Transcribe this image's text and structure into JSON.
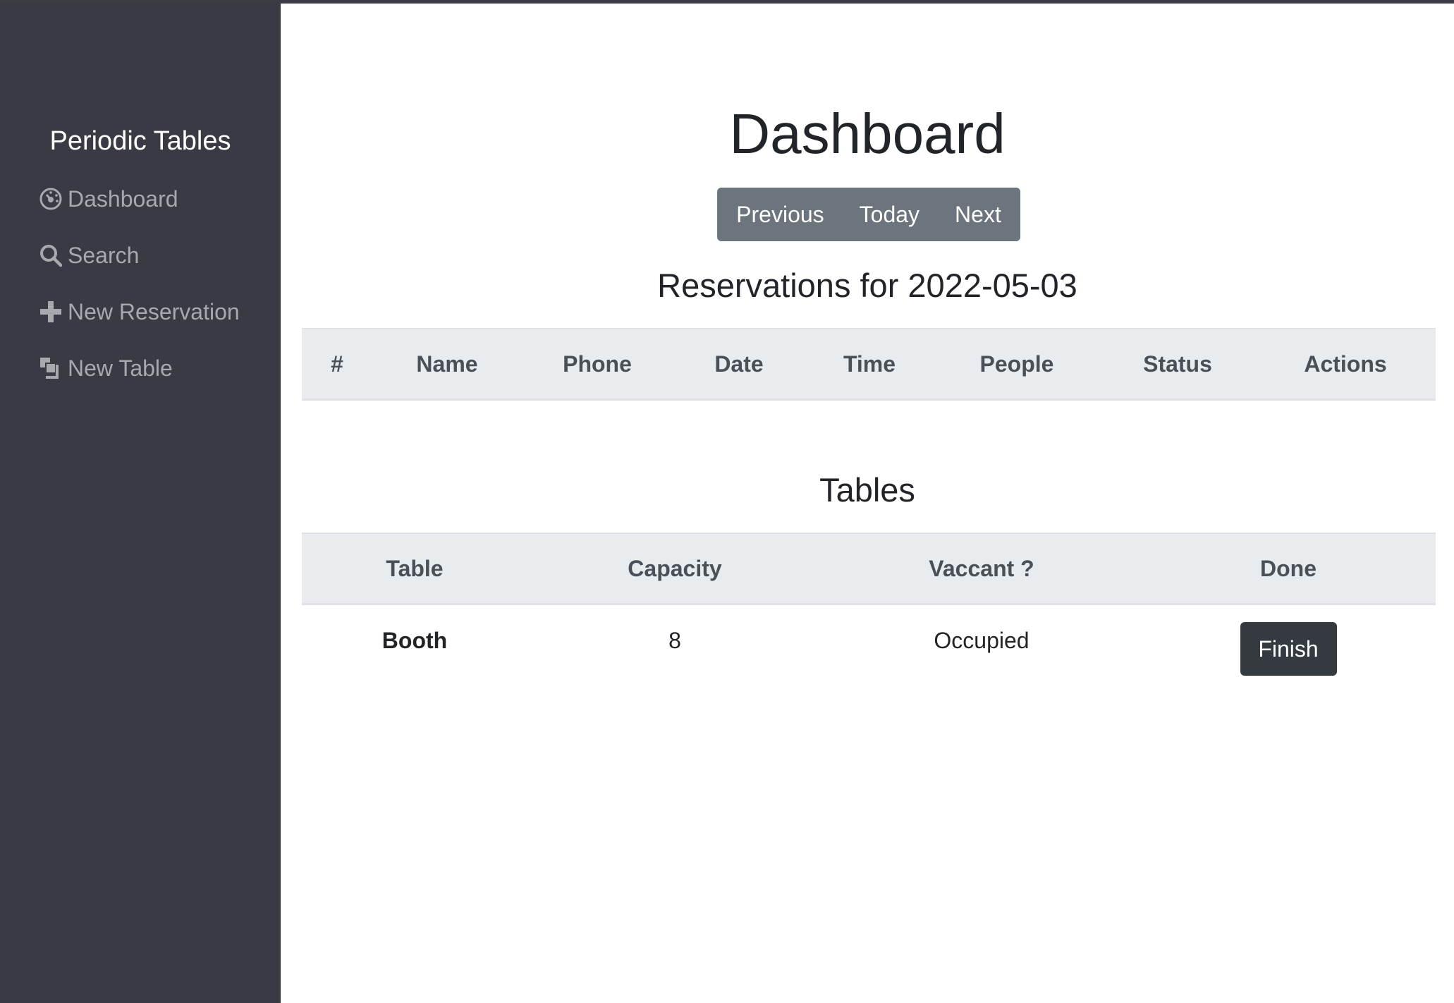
{
  "sidebar": {
    "brand": "Periodic Tables",
    "items": [
      {
        "label": "Dashboard",
        "icon": "dashboard-icon"
      },
      {
        "label": "Search",
        "icon": "search-icon"
      },
      {
        "label": "New Reservation",
        "icon": "plus-icon"
      },
      {
        "label": "New Table",
        "icon": "tables-icon"
      }
    ]
  },
  "main": {
    "title": "Dashboard",
    "nav_buttons": {
      "previous": "Previous",
      "today": "Today",
      "next": "Next"
    },
    "reservations_heading": "Reservations for 2022-05-03",
    "reservations_table": {
      "headers": [
        "#",
        "Name",
        "Phone",
        "Date",
        "Time",
        "People",
        "Status",
        "Actions"
      ],
      "rows": []
    },
    "tables_heading": "Tables",
    "tables_table": {
      "headers": [
        "Table",
        "Capacity",
        "Vaccant ?",
        "Done"
      ],
      "rows": [
        {
          "name": "Booth",
          "capacity": "8",
          "status": "Occupied",
          "action": "Finish"
        }
      ]
    }
  },
  "colors": {
    "sidebar_bg": "#393a43",
    "button_group_bg": "#6c757d",
    "finish_button_bg": "#343a40",
    "table_header_bg": "#e9ecef"
  }
}
